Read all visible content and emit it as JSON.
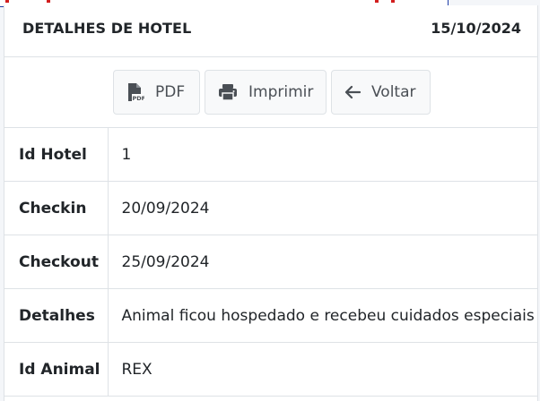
{
  "header": {
    "title": "DETALHES DE HOTEL",
    "date": "15/10/2024"
  },
  "toolbar": {
    "pdf": {
      "label": "PDF",
      "icon": "pdf-file-icon"
    },
    "print": {
      "label": "Imprimir",
      "icon": "printer-icon"
    },
    "back": {
      "label": "Voltar",
      "icon": "arrow-left-icon"
    }
  },
  "details": {
    "rows": [
      {
        "key": "Id Hotel",
        "value": "1"
      },
      {
        "key": "Checkin",
        "value": "20/09/2024"
      },
      {
        "key": "Checkout",
        "value": "25/09/2024"
      },
      {
        "key": "Detalhes",
        "value": "Animal ficou hospedado e recebeu cuidados especiais"
      },
      {
        "key": "Id Animal",
        "value": "REX"
      }
    ]
  },
  "colors": {
    "border": "#dee2e6",
    "button_bg": "#f8f9fa",
    "text": "#212529",
    "button_text": "#4a4f55"
  }
}
